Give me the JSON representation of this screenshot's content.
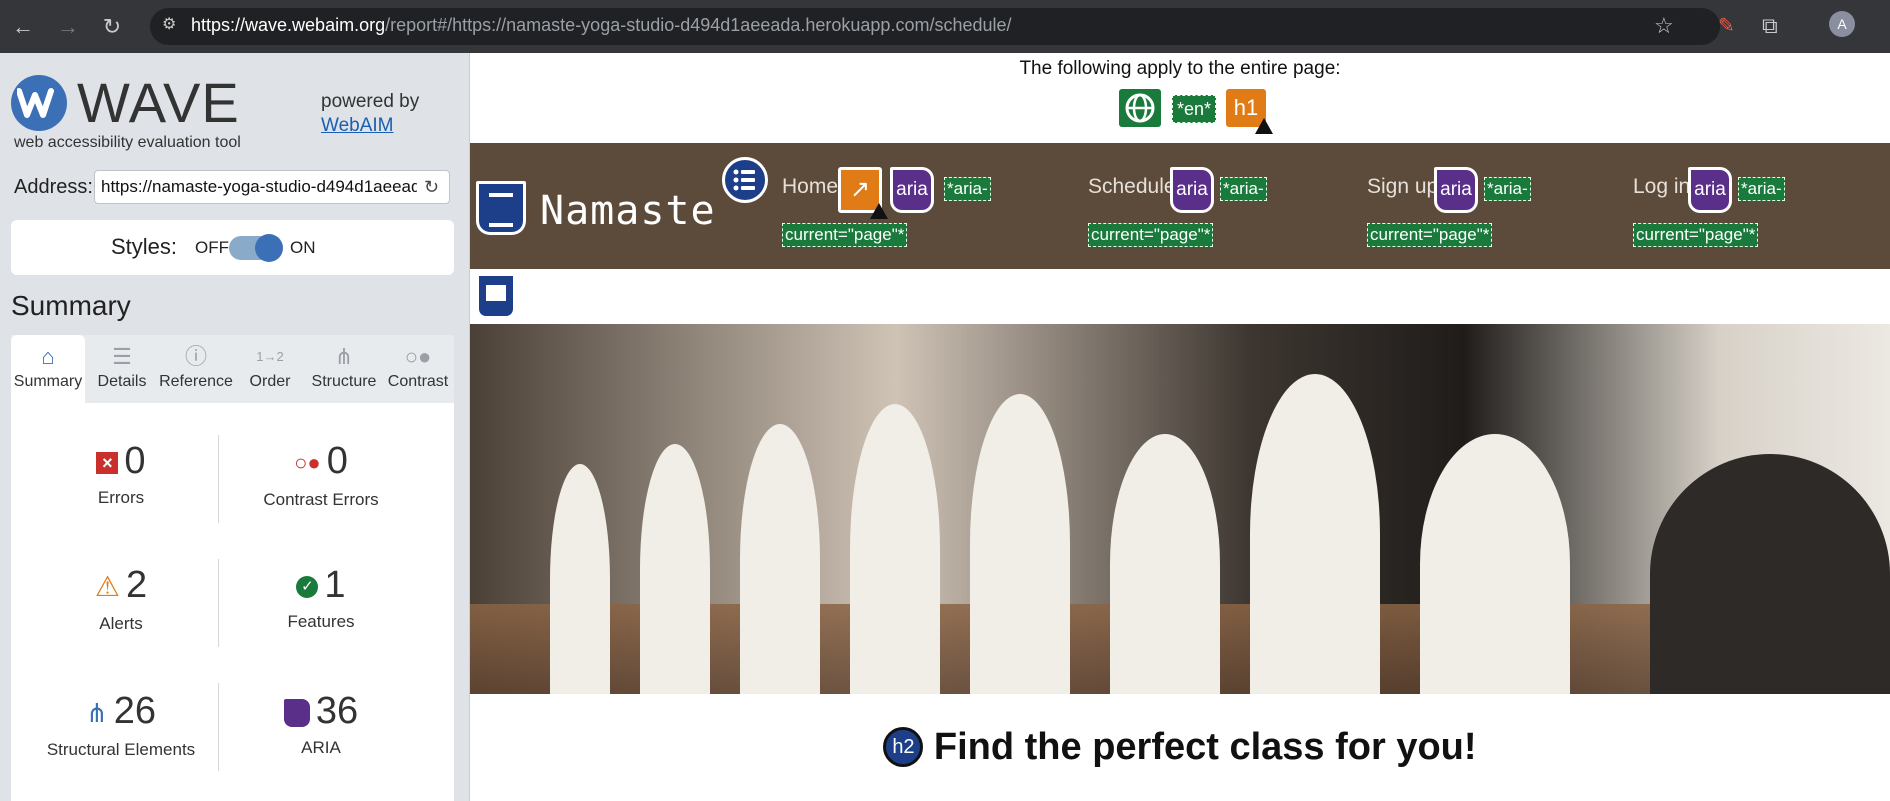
{
  "browser": {
    "url_host": "https://wave.webaim.org",
    "url_rest": "/report#/https://namaste-yoga-studio-d494d1aeeada.herokuapp.com/schedule/",
    "avatar_letter": "A"
  },
  "wave": {
    "logo_word": "WAVE",
    "tagline": "web accessibility evaluation tool",
    "powered_by": "powered by",
    "powered_link": "WebAIM",
    "address_label": "Address:",
    "address_value": "https://namaste-yoga-studio-d494d1aeeada.herokuapp.com/schedule/",
    "styles_label": "Styles:",
    "styles_off": "OFF",
    "styles_on": "ON",
    "summary_title": "Summary",
    "tabs": [
      {
        "label": "Summary",
        "icon": "home-icon"
      },
      {
        "label": "Details",
        "icon": "list-icon"
      },
      {
        "label": "Reference",
        "icon": "info-icon"
      },
      {
        "label": "Order",
        "icon": "order-icon"
      },
      {
        "label": "Structure",
        "icon": "hierarchy-icon"
      },
      {
        "label": "Contrast",
        "icon": "contrast-icon"
      }
    ],
    "stats": {
      "errors": {
        "value": "0",
        "label": "Errors"
      },
      "contrast": {
        "value": "0",
        "label": "Contrast Errors"
      },
      "alerts": {
        "value": "2",
        "label": "Alerts"
      },
      "features": {
        "value": "1",
        "label": "Features"
      },
      "structure": {
        "value": "26",
        "label": "Structural Elements"
      },
      "aria": {
        "value": "36",
        "label": "ARIA"
      }
    }
  },
  "page": {
    "apply_text": "The following apply to the entire page:",
    "lang_badge": "*en*",
    "h1_badge": "h1",
    "brand": "Namaste",
    "aria_badge": "aria",
    "nav": [
      {
        "label": "Home",
        "aria_line1": "*aria-",
        "aria_line2": "current=\"page\"*"
      },
      {
        "label": "Schedule",
        "aria_line1": "*aria-",
        "aria_line2": "current=\"page\"*"
      },
      {
        "label": "Sign up",
        "aria_line1": "*aria-",
        "aria_line2": "current=\"page\"*"
      },
      {
        "label": "Log in",
        "aria_line1": "*aria-",
        "aria_line2": "current=\"page\"*"
      }
    ],
    "h2_badge": "h2",
    "heading": "Find the perfect class for you!"
  }
}
